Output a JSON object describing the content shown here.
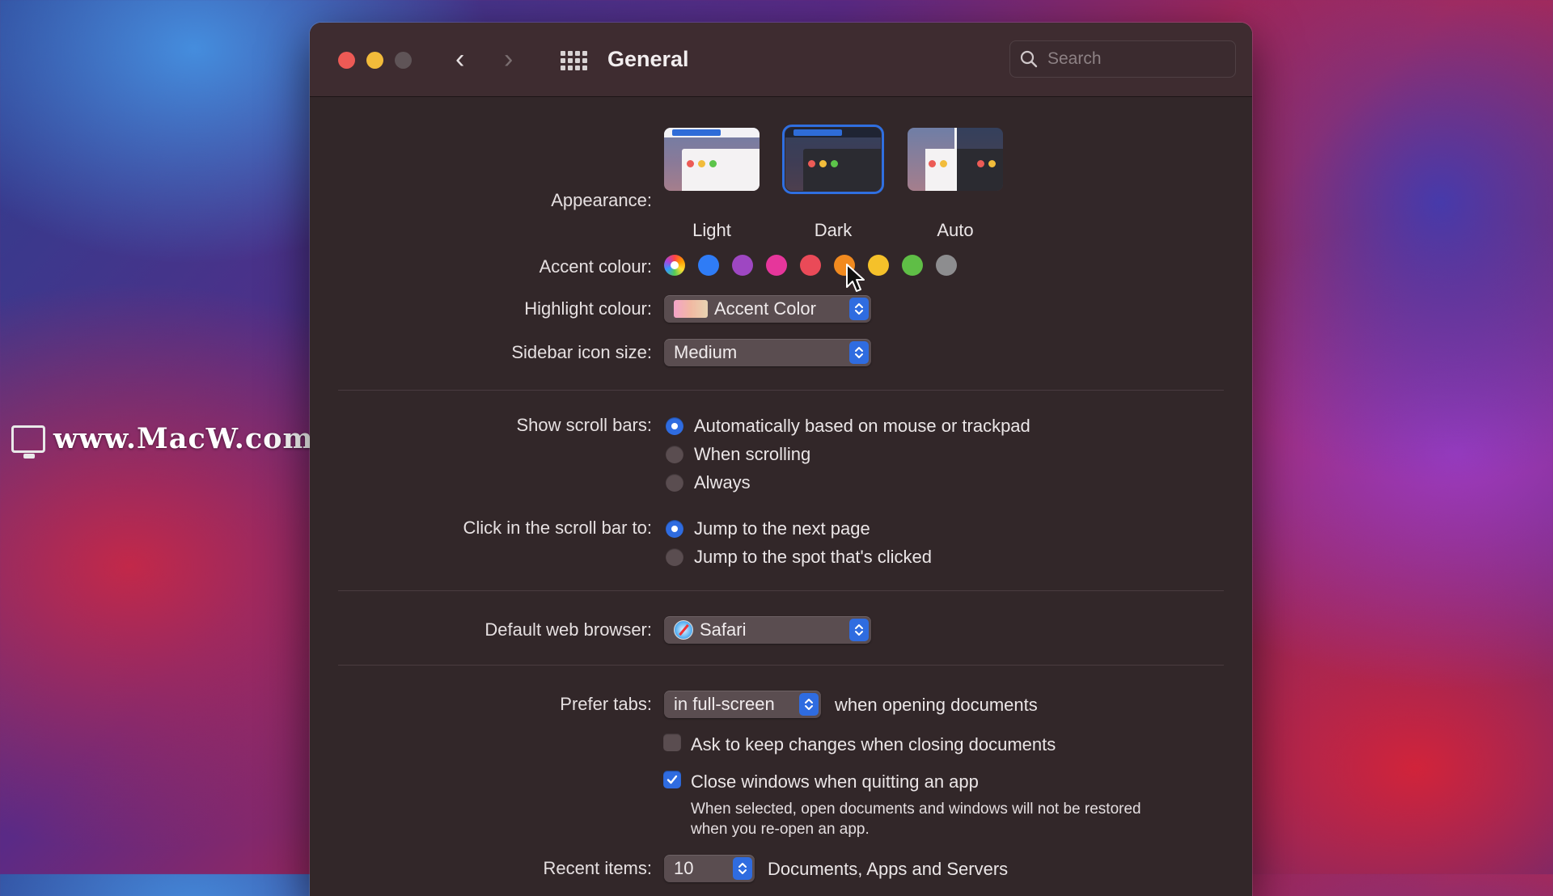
{
  "watermark": {
    "text": "www.MacW.com"
  },
  "window": {
    "title": "General",
    "search": {
      "placeholder": "Search",
      "value": ""
    }
  },
  "appearance": {
    "label": "Appearance:",
    "options": [
      {
        "caption": "Light",
        "selected": false
      },
      {
        "caption": "Dark",
        "selected": true
      },
      {
        "caption": "Auto",
        "selected": false
      }
    ]
  },
  "accent": {
    "label": "Accent colour:",
    "colors": [
      "multicolor",
      "#2f7cf6",
      "#9e47c2",
      "#e6369b",
      "#ea4a58",
      "#f18a1f",
      "#f5c12a",
      "#5fbe46",
      "#8d8d8f"
    ],
    "selected_index": 0
  },
  "highlight": {
    "label": "Highlight colour:",
    "value": "Accent Color"
  },
  "sidebar_icon": {
    "label": "Sidebar icon size:",
    "value": "Medium"
  },
  "scroll_bars": {
    "label": "Show scroll bars:",
    "options": [
      {
        "text": "Automatically based on mouse or trackpad",
        "selected": true
      },
      {
        "text": "When scrolling",
        "selected": false
      },
      {
        "text": "Always",
        "selected": false
      }
    ]
  },
  "click_scroll": {
    "label": "Click in the scroll bar to:",
    "options": [
      {
        "text": "Jump to the next page",
        "selected": true
      },
      {
        "text": "Jump to the spot that's clicked",
        "selected": false
      }
    ]
  },
  "browser": {
    "label": "Default web browser:",
    "value": "Safari"
  },
  "prefer_tabs": {
    "label": "Prefer tabs:",
    "value": "in full-screen",
    "suffix": "when opening documents"
  },
  "ask_keep": {
    "text": "Ask to keep changes when closing documents",
    "checked": false
  },
  "close_windows": {
    "text": "Close windows when quitting an app",
    "checked": true,
    "note_line1": "When selected, open documents and windows will not be restored",
    "note_line2": "when you re-open an app."
  },
  "recent": {
    "label": "Recent items:",
    "value": "10",
    "suffix": "Documents, Apps and Servers"
  }
}
